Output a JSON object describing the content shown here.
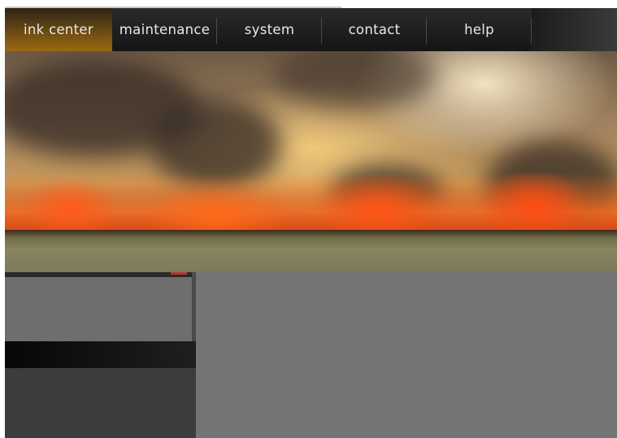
{
  "nav": {
    "items": [
      {
        "label": "ink center",
        "active": true
      },
      {
        "label": "maintenance",
        "active": false
      },
      {
        "label": "system",
        "active": false
      },
      {
        "label": "contact",
        "active": false
      },
      {
        "label": "help",
        "active": false
      }
    ]
  },
  "hero": {
    "image": "wildfire-banner"
  },
  "colors": {
    "nav_background": "#1a1a1a",
    "active_tab": "#8a5e12",
    "panel_gray": "#747474",
    "dark_panel": "#3c3c3c"
  }
}
